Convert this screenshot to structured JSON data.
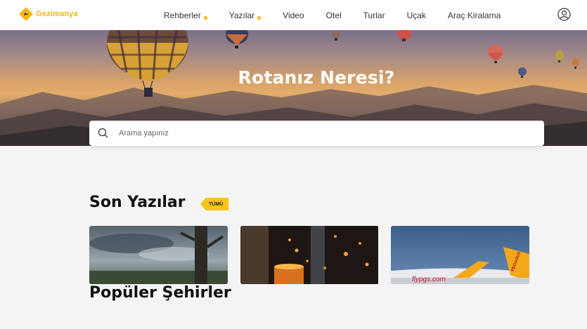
{
  "header": {
    "logo_text": "Gezimanya",
    "nav": [
      {
        "label": "Rehberler",
        "has_dot": true
      },
      {
        "label": "Yazılar",
        "has_dot": true
      },
      {
        "label": "Video",
        "has_dot": false
      },
      {
        "label": "Otel",
        "has_dot": false
      },
      {
        "label": "Turlar",
        "has_dot": false
      },
      {
        "label": "Uçak",
        "has_dot": false
      },
      {
        "label": "Araç Kiralama",
        "has_dot": false
      }
    ],
    "profile_icon": "user-circle-icon"
  },
  "hero": {
    "title": "Rotanız Neresi?",
    "search_placeholder": "Arama yapınız"
  },
  "recent": {
    "title": "Son Yazılar",
    "badge": "TÜMÜ",
    "cards": [
      {
        "subject": "cloudy-landscape-tree"
      },
      {
        "subject": "candle-bokeh-lights"
      },
      {
        "subject": "pegasus-airplane"
      }
    ],
    "card_flypgs_text": "flypgs.com",
    "card_pegasus_text": "PEGASUS"
  },
  "popular": {
    "title": "Popüler Şehirler"
  },
  "colors": {
    "accent": "#f5b50a",
    "badge": "#f5c518",
    "background": "#f4f4f4"
  }
}
